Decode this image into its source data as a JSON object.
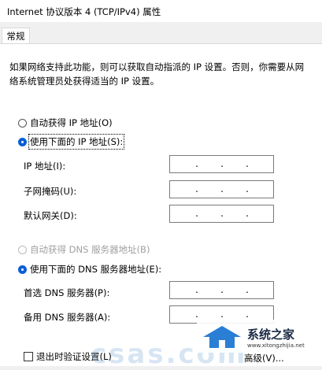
{
  "window": {
    "title": "Internet 协议版本 4 (TCP/IPv4) 属性"
  },
  "tabs": [
    {
      "label": "常规"
    }
  ],
  "description": "如果网络支持此功能，则可以获取自动指派的 IP 设置。否则，你需要从网络系统管理员处获得适当的 IP 设置。",
  "ip": {
    "auto_label": "自动获得 IP 地址(O)",
    "manual_label": "使用下面的 IP 地址(S):",
    "selected": "manual",
    "fields": [
      {
        "label": "IP 地址(I):",
        "value": ". . ."
      },
      {
        "label": "子网掩码(U):",
        "value": ". . ."
      },
      {
        "label": "默认网关(D):",
        "value": ". . ."
      }
    ]
  },
  "dns": {
    "auto_label": "自动获得 DNS 服务器地址(B)",
    "manual_label": "使用下面的 DNS 服务器地址(E):",
    "selected": "manual",
    "fields": [
      {
        "label": "首选 DNS 服务器(P):",
        "value": ". . ."
      },
      {
        "label": "备用 DNS 服务器(A):",
        "value": ". . ."
      }
    ]
  },
  "footer": {
    "validate_label": "退出时验证设置(L)",
    "advanced_label": "高级(V)..."
  },
  "watermark": {
    "text": "csas.com",
    "logo_text": "系统之家",
    "logo_url": "www.xitongzhijia.net"
  },
  "colors": {
    "accent": "#0a5ed7",
    "background": "#f0f0f0",
    "panel": "#ffffff"
  }
}
